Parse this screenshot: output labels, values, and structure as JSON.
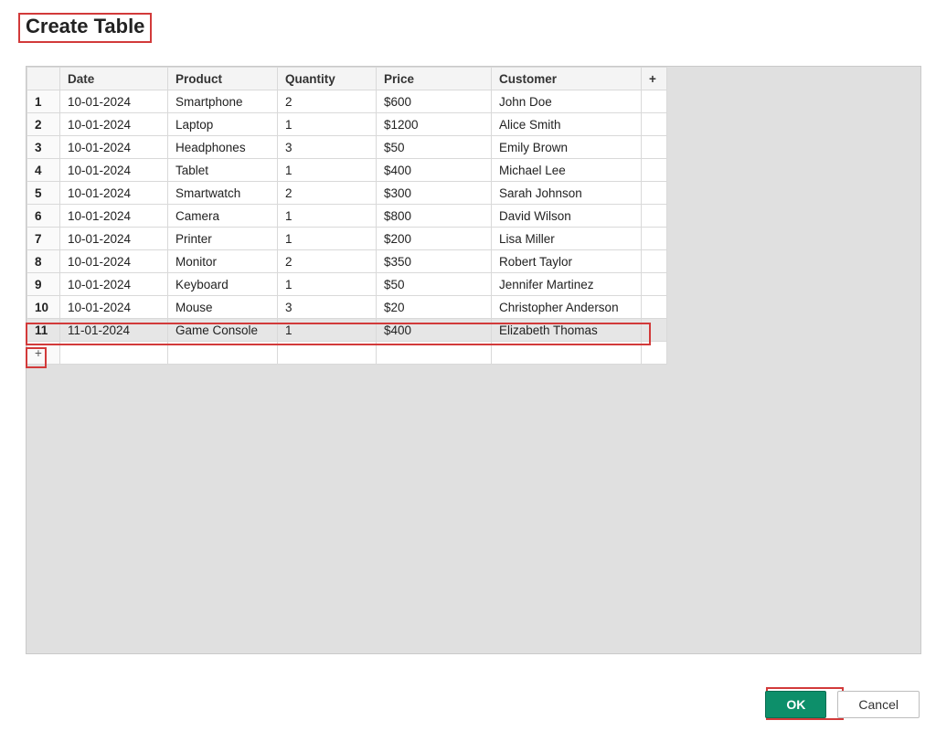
{
  "dialog": {
    "title": "Create Table"
  },
  "table": {
    "headers": {
      "date": "Date",
      "product": "Product",
      "quantity": "Quantity",
      "price": "Price",
      "customer": "Customer"
    },
    "add_column_glyph": "+",
    "add_row_glyph": "+",
    "rows": [
      {
        "n": "1",
        "date": "10-01-2024",
        "product": "Smartphone",
        "quantity": "2",
        "price": "$600",
        "customer": "John Doe"
      },
      {
        "n": "2",
        "date": "10-01-2024",
        "product": "Laptop",
        "quantity": "1",
        "price": "$1200",
        "customer": "Alice Smith"
      },
      {
        "n": "3",
        "date": "10-01-2024",
        "product": "Headphones",
        "quantity": "3",
        "price": "$50",
        "customer": "Emily Brown"
      },
      {
        "n": "4",
        "date": "10-01-2024",
        "product": "Tablet",
        "quantity": "1",
        "price": "$400",
        "customer": "Michael Lee"
      },
      {
        "n": "5",
        "date": "10-01-2024",
        "product": "Smartwatch",
        "quantity": "2",
        "price": "$300",
        "customer": "Sarah Johnson"
      },
      {
        "n": "6",
        "date": "10-01-2024",
        "product": "Camera",
        "quantity": "1",
        "price": "$800",
        "customer": "David Wilson"
      },
      {
        "n": "7",
        "date": "10-01-2024",
        "product": "Printer",
        "quantity": "1",
        "price": "$200",
        "customer": "Lisa Miller"
      },
      {
        "n": "8",
        "date": "10-01-2024",
        "product": "Monitor",
        "quantity": "2",
        "price": "$350",
        "customer": "Robert Taylor"
      },
      {
        "n": "9",
        "date": "10-01-2024",
        "product": "Keyboard",
        "quantity": "1",
        "price": "$50",
        "customer": "Jennifer Martinez"
      },
      {
        "n": "10",
        "date": "10-01-2024",
        "product": "Mouse",
        "quantity": "3",
        "price": "$20",
        "customer": "Christopher Anderson"
      },
      {
        "n": "11",
        "date": "11-01-2024",
        "product": "Game Console",
        "quantity": "1",
        "price": "$400",
        "customer": "Elizabeth Thomas"
      }
    ],
    "selected_row_index": 10
  },
  "buttons": {
    "ok": "OK",
    "cancel": "Cancel"
  }
}
